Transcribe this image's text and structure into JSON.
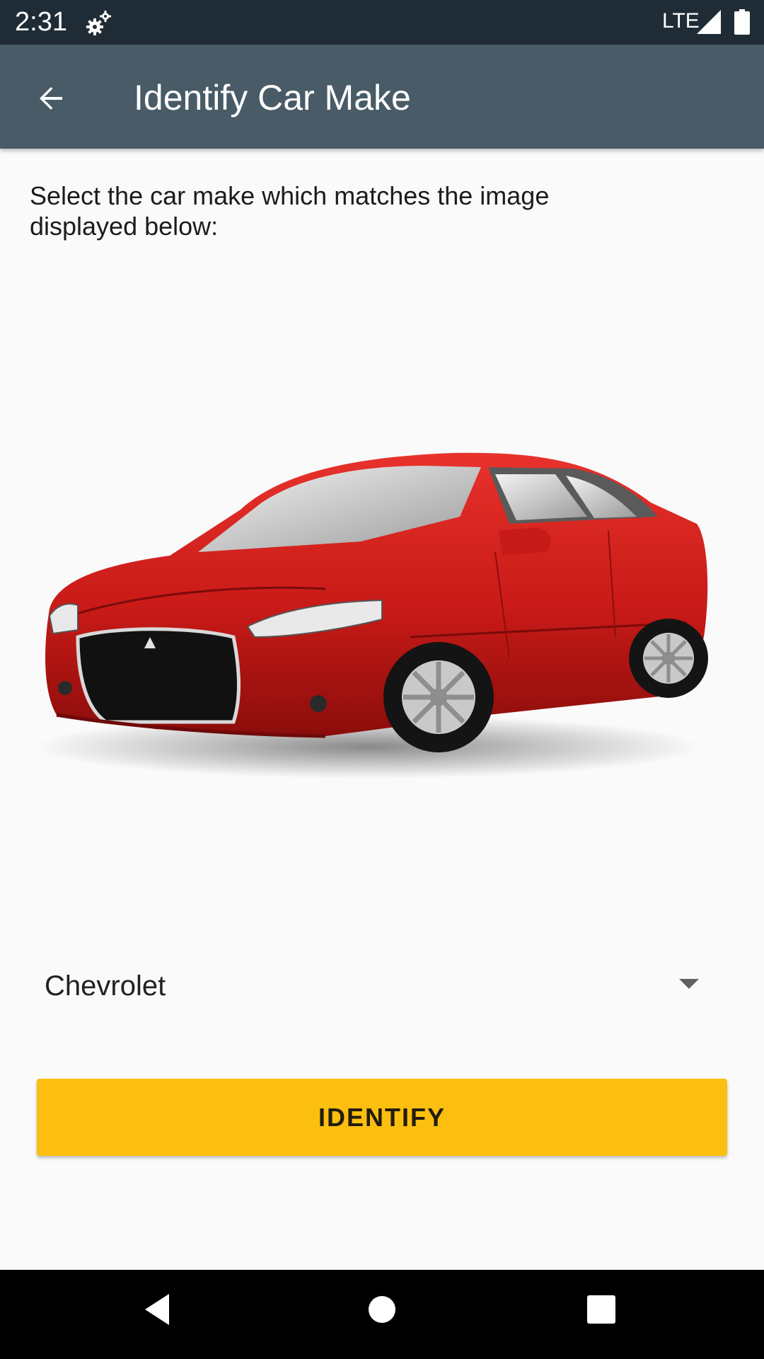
{
  "status_bar": {
    "time": "2:31",
    "network": "LTE",
    "icons": [
      "settings-icon",
      "signal-icon",
      "battery-icon"
    ]
  },
  "app_bar": {
    "title": "Identify Car Make",
    "back_icon": "arrow-back-icon"
  },
  "content": {
    "prompt": "Select the car make which matches the image displayed below:",
    "car_image_icon": "car-photo",
    "car_color": "#d41f1f",
    "selected_make": "Chevrolet",
    "identify_label": "IDENTIFY"
  },
  "colors": {
    "status_bar": "#1f2c35",
    "app_bar": "#485b67",
    "background": "#fafafa",
    "button": "#fdbf0f"
  },
  "nav_bar": {
    "icons": [
      "nav-back-icon",
      "nav-home-icon",
      "nav-recents-icon"
    ]
  }
}
